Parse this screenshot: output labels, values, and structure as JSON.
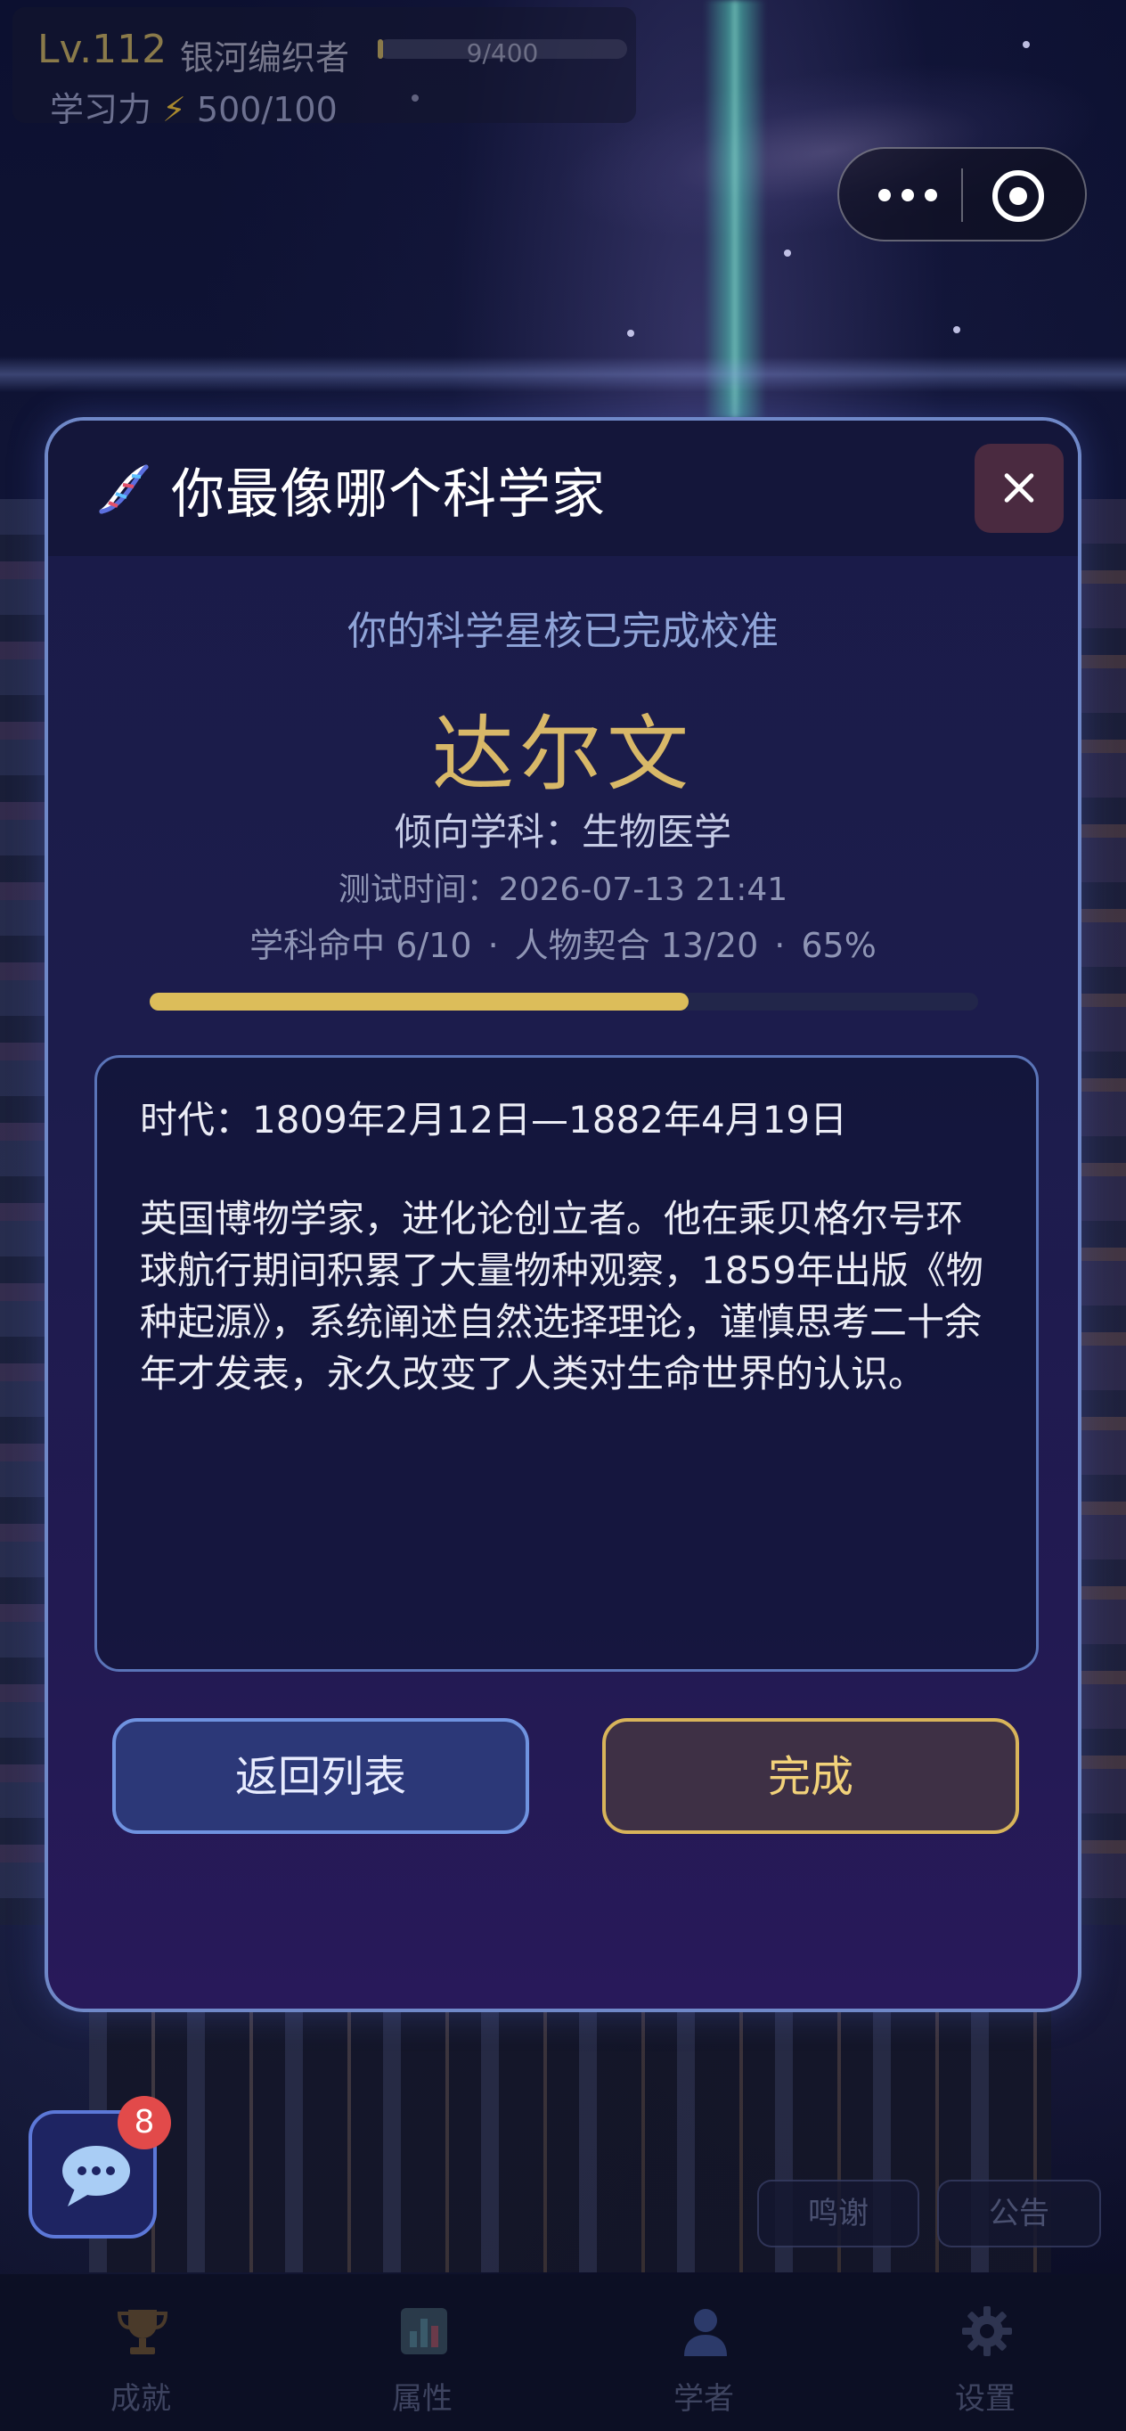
{
  "hud": {
    "level": "Lv.112",
    "title": "银河编织者",
    "xp_text": "9/400",
    "xp_fraction": 0.0225,
    "power_label": "学习力",
    "power_value": "500/100"
  },
  "capsule": {
    "more_icon": "more-dots-icon",
    "close_icon": "target-close-icon"
  },
  "modal": {
    "icon": "dna-icon",
    "title": "你最像哪个科学家",
    "subtitle": "你的科学星核已完成校准",
    "scientist": "达尔文",
    "discipline": "倾向学科：生物医学",
    "test_time": "测试时间：2026-07-13 21:41",
    "stats": {
      "discipline_hit": "学科命中 6/10",
      "character_fit": "人物契合 13/20",
      "percent": "65%",
      "separator": "·"
    },
    "progress_fraction": 0.65,
    "era": "时代：1809年2月12日—1882年4月19日",
    "bio": "英国博物学家，进化论创立者。他在乘贝格尔号环球航行期间积累了大量物种观察，1859年出版《物种起源》，系统阐述自然选择理论，谨慎思考二十余年才发表，永久改变了人类对生命世界的认识。",
    "back_label": "返回列表",
    "done_label": "完成"
  },
  "chat": {
    "badge": "8",
    "icon": "chat-bubble-icon"
  },
  "pills": {
    "thanks": "鸣谢",
    "notice": "公告"
  },
  "tabs": [
    {
      "label": "成就",
      "icon": "trophy-icon"
    },
    {
      "label": "属性",
      "icon": "bar-chart-icon"
    },
    {
      "label": "学者",
      "icon": "person-icon"
    },
    {
      "label": "设置",
      "icon": "gear-icon"
    }
  ],
  "colors": {
    "accent_gold": "#dcbd5a",
    "modal_border": "#6f88c8",
    "badge_red": "#e24a4a"
  }
}
